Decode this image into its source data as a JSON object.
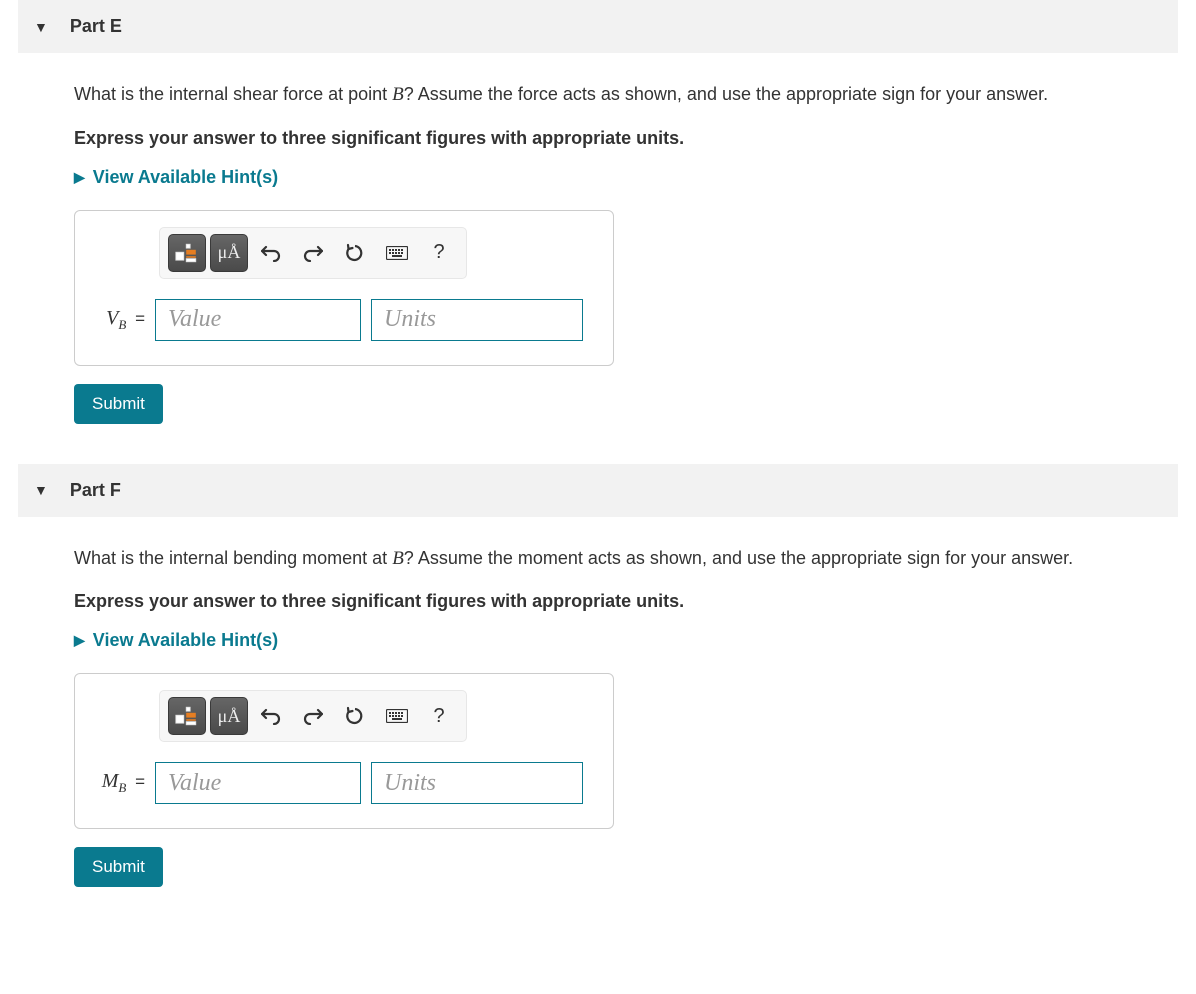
{
  "parts": [
    {
      "header": "Part E",
      "question_prefix": "What is the internal shear force at point ",
      "question_var": "B",
      "question_suffix": "? Assume the force acts as shown, and use the appropriate sign for your answer.",
      "instruction": "Express your answer to three significant figures with appropriate units.",
      "hints_label": "View Available Hint(s)",
      "toolbar": {
        "ua": "μÅ",
        "help": "?"
      },
      "var_main": "V",
      "var_sub": "B",
      "eq": " =",
      "value_placeholder": "Value",
      "units_placeholder": "Units",
      "submit": "Submit"
    },
    {
      "header": "Part F",
      "question_prefix": "What is the internal bending moment at ",
      "question_var": "B",
      "question_suffix": "? Assume the moment acts as shown, and use the appropriate sign for your answer.",
      "instruction": "Express your answer to three significant figures with appropriate units.",
      "hints_label": "View Available Hint(s)",
      "toolbar": {
        "ua": "μÅ",
        "help": "?"
      },
      "var_main": "M",
      "var_sub": "B",
      "eq": " =",
      "value_placeholder": "Value",
      "units_placeholder": "Units",
      "submit": "Submit"
    }
  ]
}
